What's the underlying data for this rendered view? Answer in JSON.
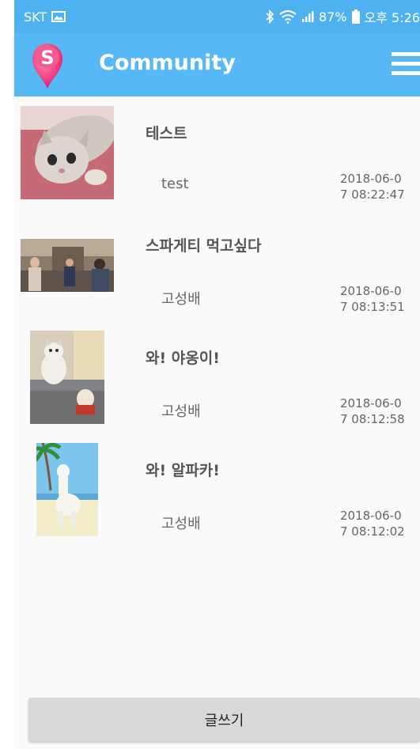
{
  "status_bar": {
    "carrier": "SKT",
    "battery": "87%",
    "time": "오후 5:26"
  },
  "app_bar": {
    "logo_letter": "S",
    "title": "Community"
  },
  "posts": [
    {
      "title": "테스트",
      "author": "test",
      "date_line1": "2018-06-0",
      "date_line2": "7 08:22:47",
      "image": "kitten-lying-photo"
    },
    {
      "title": "스파게티 먹고싶다",
      "author": "고성배",
      "date_line1": "2018-06-0",
      "date_line2": "7 08:13:51",
      "image": "people-in-room-photo"
    },
    {
      "title": "와! 야옹이!",
      "author": "고성배",
      "date_line1": "2018-06-0",
      "date_line2": "7 08:12:58",
      "image": "cat-on-sofa-photo"
    },
    {
      "title": "와! 알파카!",
      "author": "고성배",
      "date_line1": "2018-06-0",
      "date_line2": "7 08:12:02",
      "image": "alpaca-beach-photo"
    }
  ],
  "write_button": {
    "label": "글쓰기"
  },
  "colors": {
    "status_bar": "#4fb2f0",
    "app_bar": "#56b9f5",
    "logo_pink": "#f0407f",
    "button_gray": "#d9d9d9"
  }
}
